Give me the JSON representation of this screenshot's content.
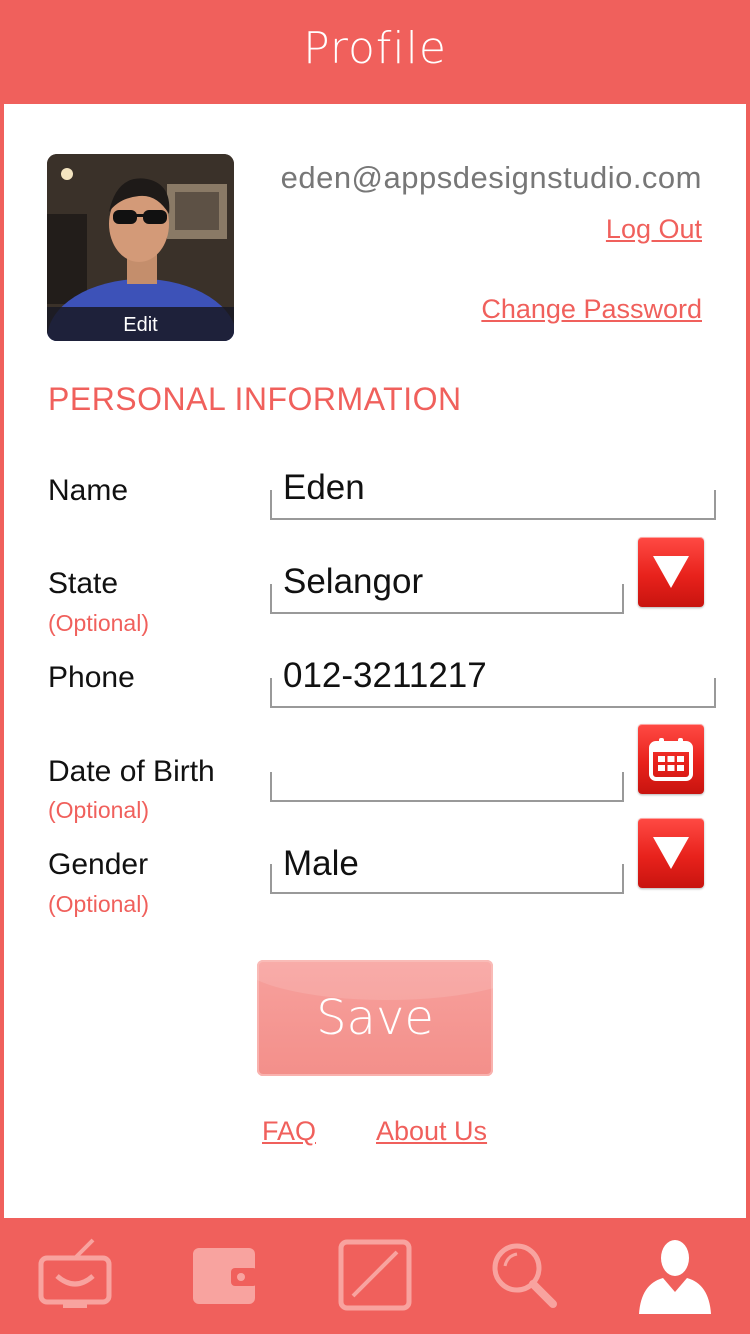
{
  "header": {
    "title": "Profile"
  },
  "profile": {
    "avatar_edit_label": "Edit",
    "email": "eden@appsdesignstudio.com",
    "logout_label": "Log Out",
    "change_password_label": "Change Password"
  },
  "personal_info": {
    "section_title": "PERSONAL INFORMATION",
    "optional_label": "(Optional)",
    "fields": {
      "name": {
        "label": "Name",
        "value": "Eden"
      },
      "state": {
        "label": "State",
        "value": "Selangor"
      },
      "phone": {
        "label": "Phone",
        "value": "012-3211217"
      },
      "dob": {
        "label": "Date of Birth",
        "value": ""
      },
      "gender": {
        "label": "Gender",
        "value": "Male"
      }
    }
  },
  "actions": {
    "save_label": "Save"
  },
  "footer_links": {
    "faq": "FAQ",
    "about": "About Us"
  },
  "tabbar": {
    "items": [
      {
        "icon": "tv-icon",
        "active": false
      },
      {
        "icon": "wallet-icon",
        "active": false
      },
      {
        "icon": "expand-icon",
        "active": false
      },
      {
        "icon": "search-icon",
        "active": false
      },
      {
        "icon": "user-icon",
        "active": true
      }
    ]
  },
  "colors": {
    "accent": "#f0605c",
    "dropdown_button": "#e8221c",
    "save_button": "#f38f8a",
    "tab_inactive": "#f8a39f",
    "tab_active": "#ffffff"
  }
}
